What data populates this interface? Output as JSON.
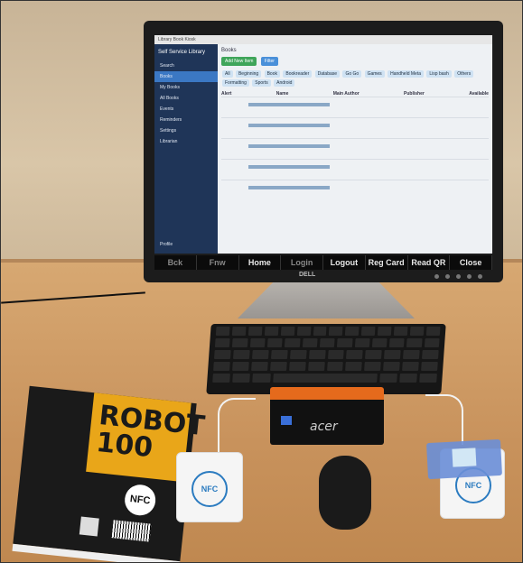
{
  "app": {
    "window_title": "Library Book Kiosk",
    "title": "Library",
    "sidebar_heading": "Self Service Library",
    "sidebar_items": [
      "Search",
      "Books",
      "My Books",
      "All Books",
      "Events",
      "Reminders",
      "Settings",
      "Librarian",
      "Profile"
    ],
    "page_title": "Books",
    "add_button": "Add New Item",
    "filter_button": "Filter",
    "categories": [
      "All",
      "Beginning",
      "Book",
      "Bookreader",
      "Database",
      "Go Go",
      "Go Go",
      "Games",
      "Handheld Meta",
      "Lisp bash",
      "Others",
      "Formatting",
      "Sports",
      "Android"
    ],
    "columns": [
      "Alert",
      "Name",
      "Main Author",
      "Publisher",
      "Available"
    ]
  },
  "toolbar_keys": [
    "Bck",
    "Fnw",
    "Home",
    "Login",
    "Logout",
    "Reg Card",
    "Read QR",
    "Close"
  ],
  "monitor_brand": "DELL",
  "minipc_brand": "acer",
  "book": {
    "title": "ROBOT 100",
    "label": "NFC"
  },
  "reader_labels": [
    "NFC",
    "NFC"
  ],
  "colors": {
    "screen_sidebar": "#1f3558",
    "accent": "#3b78c4",
    "pc_orange": "#e56a1c",
    "book_yellow": "#e9a619"
  }
}
